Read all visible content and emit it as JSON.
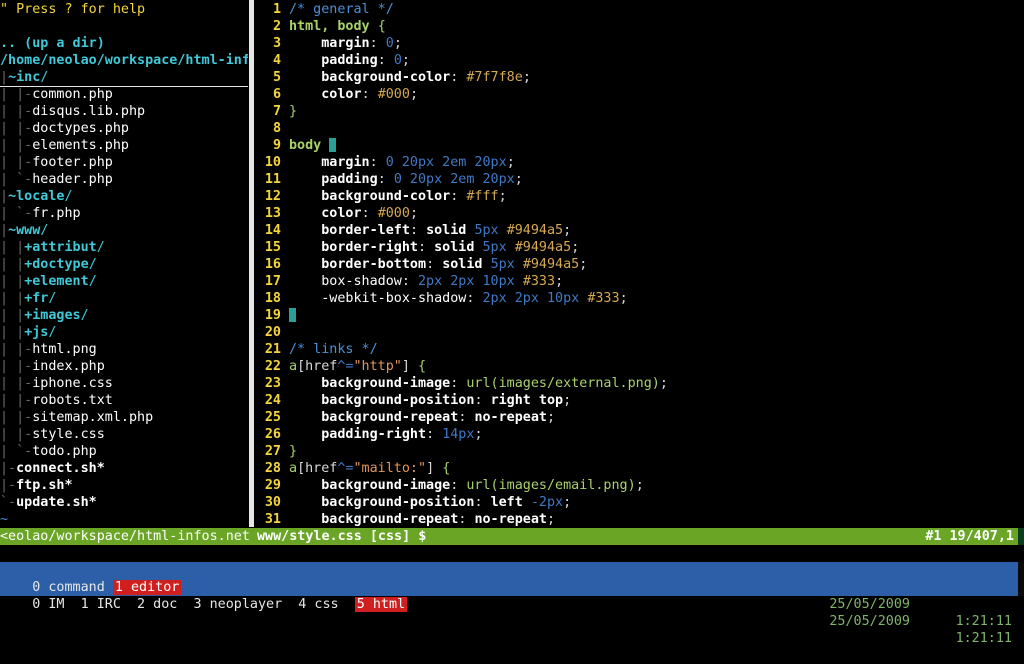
{
  "tree": {
    "help": "\" Press ? for help",
    "up_dir": ".. (up a dir)",
    "cwd": "/home/neolao/workspace/html-inf",
    "entries": [
      {
        "prefix": "|",
        "name": "~inc",
        "suffix": "/",
        "type": "dir",
        "highlight": true
      },
      {
        "prefix": "| |-",
        "name": "common.php",
        "suffix": "",
        "type": "file"
      },
      {
        "prefix": "| |-",
        "name": "disqus.lib.php",
        "suffix": "",
        "type": "file"
      },
      {
        "prefix": "| |-",
        "name": "doctypes.php",
        "suffix": "",
        "type": "file"
      },
      {
        "prefix": "| |-",
        "name": "elements.php",
        "suffix": "",
        "type": "file"
      },
      {
        "prefix": "| |-",
        "name": "footer.php",
        "suffix": "",
        "type": "file"
      },
      {
        "prefix": "| `-",
        "name": "header.php",
        "suffix": "",
        "type": "file"
      },
      {
        "prefix": "|",
        "name": "~locale",
        "suffix": "/",
        "type": "dir"
      },
      {
        "prefix": "| `-",
        "name": "fr.php",
        "suffix": "",
        "type": "file"
      },
      {
        "prefix": "|",
        "name": "~www",
        "suffix": "/",
        "type": "dir"
      },
      {
        "prefix": "| |",
        "name": "+attribut",
        "suffix": "/",
        "type": "dir"
      },
      {
        "prefix": "| |",
        "name": "+doctype",
        "suffix": "/",
        "type": "dir"
      },
      {
        "prefix": "| |",
        "name": "+element",
        "suffix": "/",
        "type": "dir"
      },
      {
        "prefix": "| |",
        "name": "+fr",
        "suffix": "/",
        "type": "dir"
      },
      {
        "prefix": "| |",
        "name": "+images",
        "suffix": "/",
        "type": "dir"
      },
      {
        "prefix": "| |",
        "name": "+js",
        "suffix": "/",
        "type": "dir"
      },
      {
        "prefix": "| |-",
        "name": "html.png",
        "suffix": "",
        "type": "file"
      },
      {
        "prefix": "| |-",
        "name": "index.php",
        "suffix": "",
        "type": "file"
      },
      {
        "prefix": "| |-",
        "name": "iphone.css",
        "suffix": "",
        "type": "file"
      },
      {
        "prefix": "| |-",
        "name": "robots.txt",
        "suffix": "",
        "type": "file"
      },
      {
        "prefix": "| |-",
        "name": "sitemap.xml.php",
        "suffix": "",
        "type": "file"
      },
      {
        "prefix": "| |-",
        "name": "style.css",
        "suffix": "",
        "type": "file"
      },
      {
        "prefix": "| `-",
        "name": "todo.php",
        "suffix": "",
        "type": "file"
      },
      {
        "prefix": "|-",
        "name": "connect.sh*",
        "suffix": "",
        "type": "exec"
      },
      {
        "prefix": "|-",
        "name": "ftp.sh*",
        "suffix": "",
        "type": "exec"
      },
      {
        "prefix": "`-",
        "name": "update.sh*",
        "suffix": "",
        "type": "exec"
      }
    ],
    "tilde": "~"
  },
  "editor": {
    "lines": [
      {
        "n": "1",
        "html": "<span class='cmt'>/* general */</span>"
      },
      {
        "n": "2",
        "html": "<span class='sel'>html, body</span> <span class='brace'>{</span>"
      },
      {
        "n": "3",
        "html": "    <span class='prop'>margin</span><span class='punc'>: </span><span class='num-val'>0</span><span class='punc'>;</span>"
      },
      {
        "n": "4",
        "html": "    <span class='prop'>padding</span><span class='punc'>: </span><span class='num-val'>0</span><span class='punc'>;</span>"
      },
      {
        "n": "5",
        "html": "    <span class='prop'>background-color</span><span class='punc'>: </span><span class='hex'>#7f7f8e</span><span class='punc'>;</span>"
      },
      {
        "n": "6",
        "html": "    <span class='prop'>color</span><span class='punc'>: </span><span class='hex'>#000</span><span class='punc'>;</span>"
      },
      {
        "n": "7",
        "html": "<span class='brace'>}</span>"
      },
      {
        "n": "8",
        "html": ""
      },
      {
        "n": "9",
        "html": "<span class='sel'>body</span> <span class='cursor'></span>"
      },
      {
        "n": "10",
        "html": "    <span class='prop'>margin</span><span class='punc'>: </span><span class='num-val'>0 20px 2em 20px</span><span class='punc'>;</span>"
      },
      {
        "n": "11",
        "html": "    <span class='prop'>padding</span><span class='punc'>: </span><span class='num-val'>0 20px 2em 20px</span><span class='punc'>;</span>"
      },
      {
        "n": "12",
        "html": "    <span class='prop'>background-color</span><span class='punc'>: </span><span class='hex'>#fff</span><span class='punc'>;</span>"
      },
      {
        "n": "13",
        "html": "    <span class='prop'>color</span><span class='punc'>: </span><span class='hex'>#000</span><span class='punc'>;</span>"
      },
      {
        "n": "14",
        "html": "    <span class='prop'>border-left</span><span class='punc'>: </span><span class='kw'>solid</span> <span class='num-val'>5px</span> <span class='hex'>#9494a5</span><span class='punc'>;</span>"
      },
      {
        "n": "15",
        "html": "    <span class='prop'>border-right</span><span class='punc'>: </span><span class='kw'>solid</span> <span class='num-val'>5px</span> <span class='hex'>#9494a5</span><span class='punc'>;</span>"
      },
      {
        "n": "16",
        "html": "    <span class='prop'>border-bottom</span><span class='punc'>: </span><span class='kw'>solid</span> <span class='num-val'>5px</span> <span class='hex'>#9494a5</span><span class='punc'>;</span>"
      },
      {
        "n": "17",
        "html": "    <span class='file'>box-shadow</span><span class='punc'>: </span><span class='num-val'>2px 2px 10px</span> <span class='hex'>#333</span><span class='punc'>;</span>"
      },
      {
        "n": "18",
        "html": "    <span class='file'>-webkit-box-shadow</span><span class='punc'>: </span><span class='num-val'>2px 2px 10px</span> <span class='hex'>#333</span><span class='punc'>;</span>"
      },
      {
        "n": "19",
        "html": "<span class='cursor'></span>"
      },
      {
        "n": "20",
        "html": ""
      },
      {
        "n": "21",
        "html": "<span class='cmt'>/* links */</span>"
      },
      {
        "n": "22",
        "html": "<span class='sel' style='font-weight:normal'>a</span><span class='punc'>[href</span><span class='num-val'>^=</span><span class='str'>\"http\"</span><span class='punc'>]</span> <span class='brace'>{</span>"
      },
      {
        "n": "23",
        "html": "    <span class='prop'>background-image</span><span class='punc'>: </span><span class='url'>url(images/external.png)</span><span class='punc'>;</span>"
      },
      {
        "n": "24",
        "html": "    <span class='prop'>background-position</span><span class='punc'>: </span><span class='kw'>right top</span><span class='punc'>;</span>"
      },
      {
        "n": "25",
        "html": "    <span class='prop'>background-repeat</span><span class='punc'>: </span><span class='kw'>no-repeat</span><span class='punc'>;</span>"
      },
      {
        "n": "26",
        "html": "    <span class='prop'>padding-right</span><span class='punc'>: </span><span class='num-val'>14px</span><span class='punc'>;</span>"
      },
      {
        "n": "27",
        "html": "<span class='brace'>}</span>"
      },
      {
        "n": "28",
        "html": "<span class='sel' style='font-weight:normal'>a</span><span class='punc'>[href</span><span class='num-val'>^=</span><span class='str'>\"mailto:\"</span><span class='punc'>]</span> <span class='brace'>{</span>"
      },
      {
        "n": "29",
        "html": "    <span class='prop'>background-image</span><span class='punc'>: </span><span class='url'>url(images/email.png)</span><span class='punc'>;</span>"
      },
      {
        "n": "30",
        "html": "    <span class='prop'>background-position</span><span class='punc'>: </span><span class='kw'>left</span> <span class='num-val'>-2px</span><span class='punc'>;</span>"
      },
      {
        "n": "31",
        "html": "    <span class='prop'>background-repeat</span><span class='punc'>: </span><span class='kw'>no-repeat</span><span class='punc'>;</span>"
      }
    ]
  },
  "status": {
    "left": "<eolao/workspace/html-infos.net",
    "file": "www/style.css [css] $",
    "position": "#1 19/407,1"
  },
  "screen_bar": {
    "row1": {
      "before": "0 command ",
      "active": "1 editor",
      "after": "",
      "date": "25/05/2009",
      "time": "1:21:11"
    },
    "row2": {
      "before": "0 IM  1 IRC  2 doc  3 neoplayer  4 css  ",
      "active": "5 html",
      "after": "",
      "date": "25/05/2009",
      "time": "1:21:11"
    }
  },
  "colors": {
    "status_bg": "#6aa526",
    "bar_bg": "#2c5fa8",
    "active_window": "#cf1f1f",
    "line_numbers": "#f4d53b"
  }
}
